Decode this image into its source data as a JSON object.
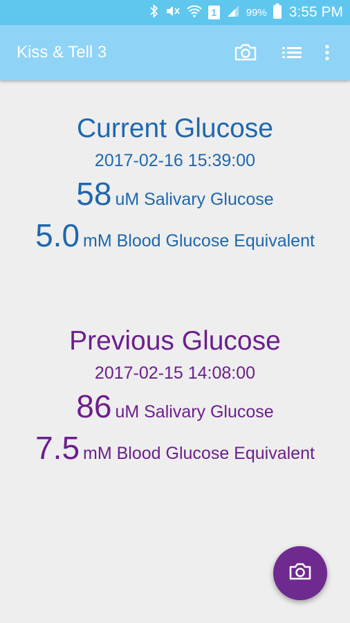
{
  "status_bar": {
    "battery_percent": "99%",
    "time": "3:55 PM",
    "sim_slot": "1"
  },
  "app_bar": {
    "title": "Kiss & Tell 3",
    "icons": [
      "camera-icon",
      "list-icon",
      "more-vert-icon"
    ]
  },
  "current": {
    "title": "Current Glucose",
    "datetime": "2017-02-16 15:39:00",
    "salivary_value": "58",
    "salivary_label": "uM Salivary Glucose",
    "blood_value": "5.0",
    "blood_label": "mM Blood Glucose Equivalent",
    "color": "#1f67ad"
  },
  "previous": {
    "title": "Previous Glucose",
    "datetime": "2017-02-15 14:08:00",
    "salivary_value": "86",
    "salivary_label": "uM Salivary Glucose",
    "blood_value": "7.5",
    "blood_label": "mM Blood Glucose Equivalent",
    "color": "#6c1f8c"
  },
  "fab": {
    "icon": "camera-icon",
    "color": "#6f2a90"
  }
}
